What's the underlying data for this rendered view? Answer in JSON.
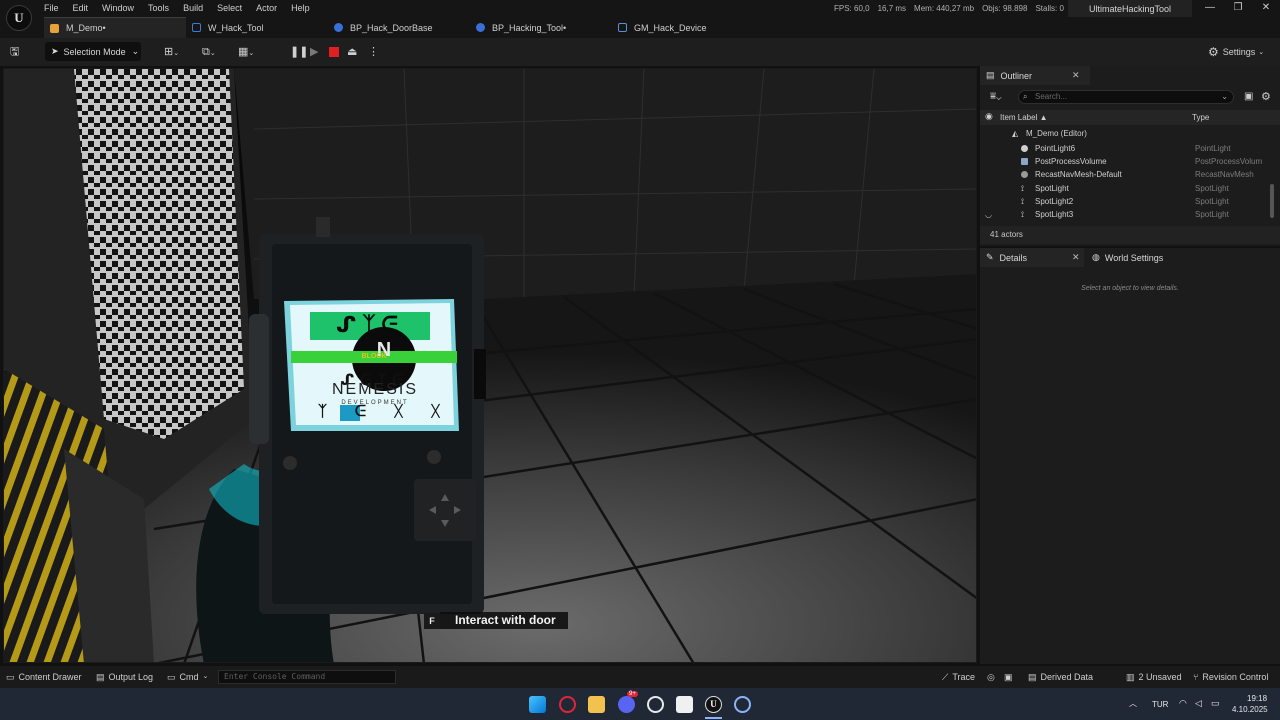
{
  "menu": [
    "File",
    "Edit",
    "Window",
    "Tools",
    "Build",
    "Select",
    "Actor",
    "Help"
  ],
  "tabs": [
    {
      "label": "M_Demo•",
      "icon": "level-icon",
      "color": "#e8a23c"
    },
    {
      "label": "W_Hack_Tool",
      "icon": "widget-icon",
      "color": "#3a7bd5"
    },
    {
      "label": "BP_Hack_DoorBase",
      "icon": "blueprint-icon",
      "color": "#3a6fd8"
    },
    {
      "label": "BP_Hacking_Tool•",
      "icon": "blueprint-icon",
      "color": "#3a6fd8"
    },
    {
      "label": "GM_Hack_Device",
      "icon": "gamemode-icon",
      "color": "#5a8fd6"
    }
  ],
  "stats": {
    "fps": "FPS: 60,0",
    "ms": "16,7 ms",
    "mem": "Mem: 440,27 mb",
    "objs": "Objs: 98.898",
    "stalls": "Stalls: 0"
  },
  "project_name": "UltimateHackingTool",
  "toolbar": {
    "selection_mode": "Selection Mode",
    "settings": "Settings"
  },
  "viewport": {
    "device": {
      "glyphs_top": "ᔑᛉᕮ",
      "logo_letter": "N",
      "status_text": "BLOCK",
      "glyphs_mid": "ᔑᕮᛉᕮ",
      "brand": "NEMESIS",
      "brand_sub": "DEVELOPMENT",
      "glyphs_bottom": [
        "ᛉ",
        "ᕮ",
        "ᚷ",
        "ᚷ"
      ]
    },
    "prompt_key": "F",
    "prompt_label": "Interact with door"
  },
  "outliner": {
    "tab_label": "Outliner",
    "search_placeholder": "Search...",
    "col_label": "Item Label ▲",
    "col_type": "Type",
    "level_row": "M_Demo (Editor)",
    "rows": [
      {
        "name": "PointLight6",
        "type": "PointLight",
        "icon": "pointlight-icon"
      },
      {
        "name": "PostProcessVolume",
        "type": "PostProcessVolum",
        "icon": "postprocess-icon"
      },
      {
        "name": "RecastNavMesh-Default",
        "type": "RecastNavMesh",
        "icon": "navmesh-icon"
      },
      {
        "name": "SpotLight",
        "type": "SpotLight",
        "icon": "spotlight-icon"
      },
      {
        "name": "SpotLight2",
        "type": "SpotLight",
        "icon": "spotlight-icon"
      },
      {
        "name": "SpotLight3",
        "type": "SpotLight",
        "icon": "spotlight-icon"
      }
    ],
    "actor_count": "41 actors"
  },
  "details": {
    "tab_label": "Details",
    "world_settings_label": "World Settings",
    "hint": "Select an object to view details."
  },
  "statusbar": {
    "content_drawer": "Content Drawer",
    "output_log": "Output Log",
    "cmd": "Cmd",
    "console_placeholder": "Enter Console Command",
    "trace": "Trace",
    "derived_data": "Derived Data",
    "unsaved": "2 Unsaved",
    "revision_control": "Revision Control"
  },
  "taskbar": {
    "icons": [
      "windows-start-icon",
      "opera-icon",
      "file-explorer-icon",
      "discord-icon",
      "chatgpt-icon",
      "capcut-icon",
      "unreal-icon",
      "settings-icon"
    ],
    "discord_badge": "9+",
    "language": "TUR",
    "time": "19:18",
    "date": "4.10.2025"
  }
}
